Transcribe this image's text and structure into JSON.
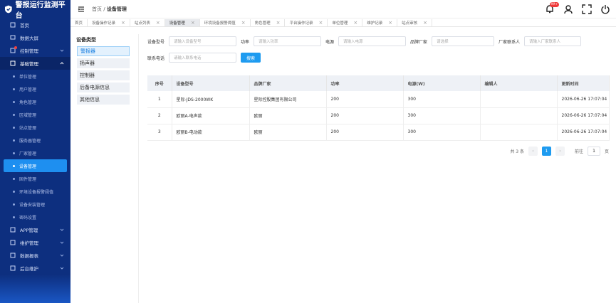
{
  "brand": {
    "title": "警报运行监测平台"
  },
  "header": {
    "crumb_home": "首页",
    "crumb_sep": "/",
    "crumb_current": "设备管理",
    "notif_badge": "99+"
  },
  "sidebar": {
    "items": [
      {
        "label": "首页"
      },
      {
        "label": "数据大屏"
      },
      {
        "label": "控制管理"
      },
      {
        "label": "基础管理"
      }
    ],
    "subitems": [
      "单位管理",
      "用户管理",
      "角色管理",
      "区域管理",
      "站点管理",
      "服务器管理",
      "厂家管理",
      "设备管理",
      "固件管理",
      "环境设备报警阈值",
      "设备安装管理",
      "密码设置"
    ],
    "bottom": [
      {
        "label": "APP管理"
      },
      {
        "label": "维护管理"
      },
      {
        "label": "数据报表"
      },
      {
        "label": "后台维护"
      }
    ]
  },
  "tabs": [
    "首页",
    "设备操作记录",
    "站点列表",
    "设备管理",
    "环境设备报警阈值",
    "角色管理",
    "平台操作记录",
    "单位管理",
    "维护记录",
    "站点审核"
  ],
  "leftpanel": {
    "title": "设备类型",
    "items": [
      "警报器",
      "扬声器",
      "控制器",
      "后备电源信息",
      "其他信息"
    ]
  },
  "form": {
    "model_label": "设备型号",
    "model_ph": "请输入设备型号",
    "power_label": "功率",
    "power_ph": "请输入功率",
    "current_label": "电源",
    "current_ph": "请输入电源",
    "brand_label": "品牌厂家",
    "brand_ph": "请选择",
    "contact_label": "厂家联系人",
    "contact_ph": "请输入厂家联系人",
    "phone_label": "联系电话",
    "phone_ph": "请输入联系电话",
    "search_btn": "搜索"
  },
  "table": {
    "headers": [
      "序号",
      "设备型号",
      "品牌厂家",
      "功率",
      "电源(W)",
      "编辑人",
      "更新时间"
    ],
    "rows": [
      [
        "1",
        "星际-JDS-2000WK",
        "星际控股集团有限公司",
        "200",
        "300",
        "",
        "2026-06-26 17:07:04"
      ],
      [
        "2",
        "欧丽A-电声款",
        "欧丽",
        "200",
        "300",
        "",
        "2026-06-26 17:07:04"
      ],
      [
        "3",
        "欧丽B-电动款",
        "欧丽",
        "200",
        "300",
        "",
        "2026-06-26 17:07:04"
      ]
    ]
  },
  "pager": {
    "total": "共 3 条",
    "prev": "‹",
    "page": "1",
    "next": "›",
    "goto": "前往",
    "goto_val": "1",
    "unit": "页"
  },
  "colors": {
    "sidebar": "#0d2f7f",
    "accent": "#1e9bf0"
  }
}
